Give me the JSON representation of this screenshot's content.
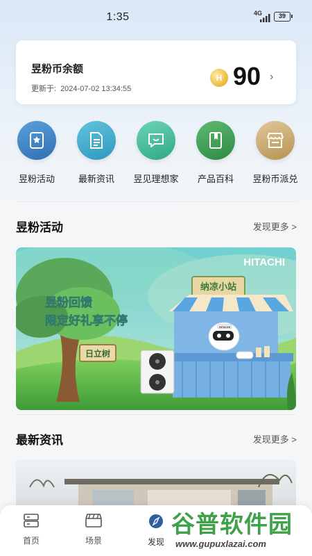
{
  "status_bar": {
    "time": "1:35",
    "network": "4G",
    "battery": "39"
  },
  "balance": {
    "title": "昱粉币余额",
    "update_label": "更新于:",
    "update_time": "2024-07-02 13:34:55",
    "coin_icon": "coin-icon",
    "coin_symbol": "H",
    "value": "90",
    "arrow": "›"
  },
  "quick_menu": [
    {
      "label": "昱粉活动",
      "icon": "star-bookmark-icon",
      "color": "#3a7fc0"
    },
    {
      "label": "最新资讯",
      "icon": "document-icon",
      "color": "#3aa8c8"
    },
    {
      "label": "昱见理想家",
      "icon": "chat-bubble-icon",
      "color": "#43b89a"
    },
    {
      "label": "产品百科",
      "icon": "book-icon",
      "color": "#3f9e55"
    },
    {
      "label": "昱粉币派兑",
      "icon": "store-icon",
      "color": "#c9a86e"
    }
  ],
  "activity_section": {
    "title": "昱粉活动",
    "more": "发现更多 >"
  },
  "banner": {
    "brand": "HITACHI",
    "headline_line1": "昱粉回馈",
    "headline_line2": "限定好礼享不停",
    "stall_sign": "纳凉小站",
    "tree_sign": "日立树",
    "robot_badge": "HITACHI"
  },
  "news_section": {
    "title": "最新资讯",
    "more": "发现更多 >"
  },
  "tab_bar": [
    {
      "label": "首页",
      "icon": "home-list-icon"
    },
    {
      "label": "场景",
      "icon": "clapperboard-icon"
    },
    {
      "label": "发现",
      "icon": "compass-icon"
    }
  ],
  "watermark": {
    "title": "谷普软件园",
    "url": "www.gupuxlazai.com"
  }
}
